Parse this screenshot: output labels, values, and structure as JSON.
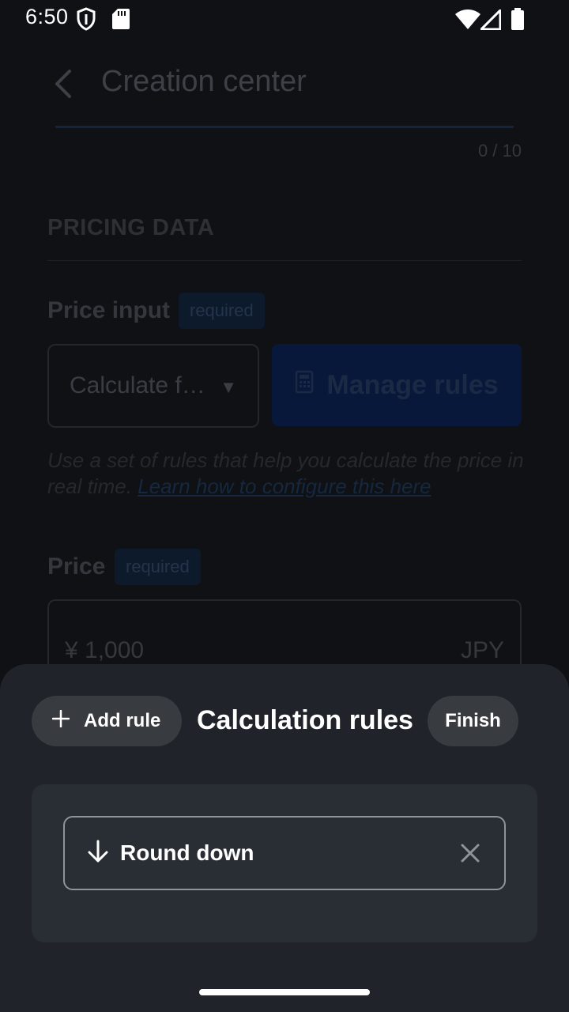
{
  "status_bar": {
    "time": "6:50"
  },
  "background_page": {
    "title": "Creation center",
    "counter": "0 / 10",
    "section_title": "PRICING DATA",
    "price_input": {
      "label": "Price input",
      "badge": "required",
      "select_value": "Calculate f…",
      "manage_button": "Manage rules",
      "help_text": "Use a set of rules that help you calculate the price in real time. ",
      "help_link": "Learn how to configure this here"
    },
    "price": {
      "label": "Price",
      "badge": "required",
      "value": "¥  1,000",
      "currency": "JPY"
    }
  },
  "sheet": {
    "add_rule_label": "Add rule",
    "title": "Calculation rules",
    "finish_label": "Finish",
    "rules": [
      {
        "label": "Round down",
        "icon": "arrow-down-icon"
      }
    ]
  },
  "colors": {
    "sheet_bg": "#202329",
    "button_bg": "#383b40",
    "panel_bg": "#292d34",
    "accent_dim": "#07183a"
  }
}
